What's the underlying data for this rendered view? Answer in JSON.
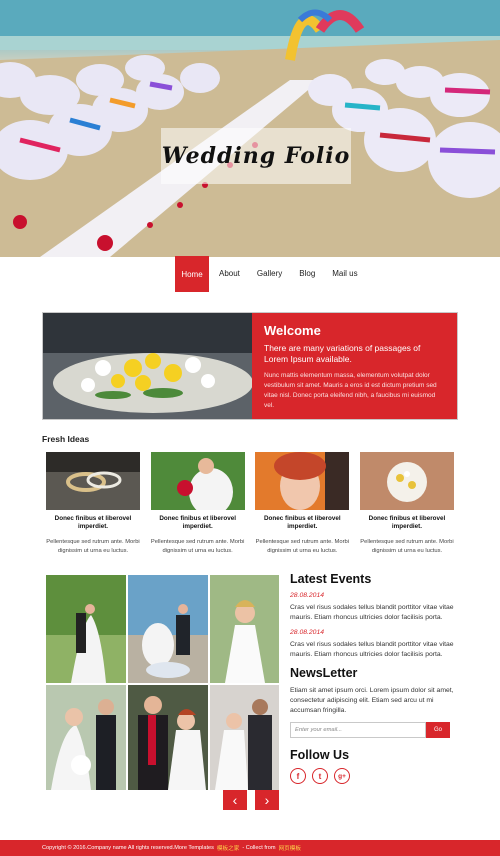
{
  "hero": {
    "title": "Wedding Folio"
  },
  "nav": {
    "items": [
      {
        "label": "Home",
        "active": true
      },
      {
        "label": "About"
      },
      {
        "label": "Gallery"
      },
      {
        "label": "Blog"
      },
      {
        "label": "Mail us"
      }
    ]
  },
  "welcome": {
    "title": "Welcome",
    "subtitle": "There are many variations of passages of Lorem Ipsum available.",
    "body": "Nunc mattis elementum massa, elementum volutpat dolor vestibulum sit amet. Mauris a eros id est dictum pretium sed vitae nisl. Donec porta eleifend nibh, a faucibus mi euismod vel."
  },
  "fresh_ideas": {
    "heading": "Fresh Ideas",
    "items": [
      {
        "title": "Donec finibus et liberovel imperdiet.",
        "text": "Pellentesque sed rutrum ante. Morbi dignissim ut urna eu luctus."
      },
      {
        "title": "Donec finibus et liberovel imperdiet.",
        "text": "Pellentesque sed rutrum ante. Morbi dignissim ut urna eu luctus."
      },
      {
        "title": "Donec finibus et liberovel imperdiet.",
        "text": "Pellentesque sed rutrum ante. Morbi dignissim ut urna eu luctus."
      },
      {
        "title": "Donec finibus et liberovel imperdiet.",
        "text": "Pellentesque sed rutrum ante. Morbi dignissim ut urna eu luctus."
      }
    ]
  },
  "gallery": {
    "prev_icon": "‹",
    "next_icon": "›"
  },
  "latest_events": {
    "heading": "Latest Events",
    "items": [
      {
        "date": "28.08.2014",
        "text": "Cras vel risus sodales tellus blandit porttitor vitae vitae mauris. Etiam rhoncus ultricies dolor facilisis porta."
      },
      {
        "date": "28.08.2014",
        "text": "Cras vel risus sodales tellus blandit porttitor vitae vitae mauris. Etiam rhoncus ultricies dolor facilisis porta."
      }
    ]
  },
  "newsletter": {
    "heading": "NewsLetter",
    "text": "Etiam sit amet ipsum orci. Lorem ipsum dolor sit amet, consectetur adipiscing elit. Etiam sed arcu ut mi accumsan fringilla.",
    "placeholder": "Enter your email...",
    "button": "Go"
  },
  "follow": {
    "heading": "Follow Us",
    "icons": [
      "f",
      "t",
      "g+"
    ]
  },
  "footer": {
    "copyright": "Copyright © 2016.Company name All rights reserved.More Templates",
    "link1": "模板之家",
    "collect": "- Collect from",
    "link2": "网页模板"
  },
  "colors": {
    "accent": "#d8262b"
  }
}
